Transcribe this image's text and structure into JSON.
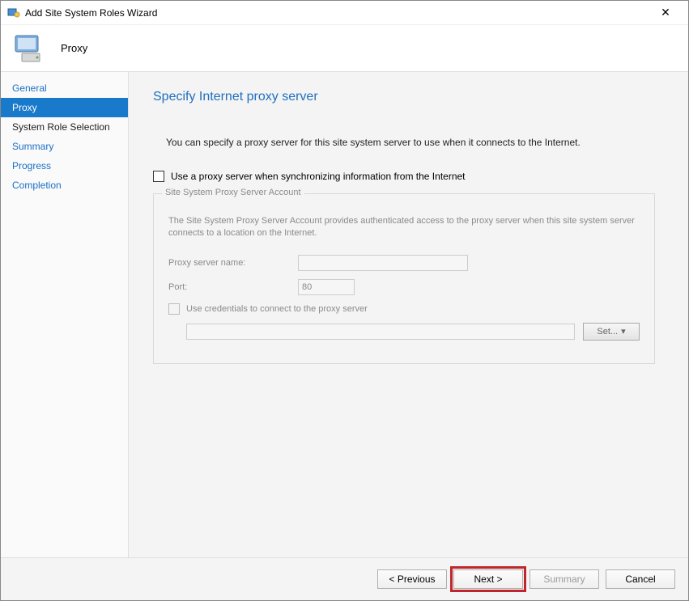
{
  "window": {
    "title": "Add Site System Roles Wizard"
  },
  "header": {
    "page_name": "Proxy"
  },
  "sidebar": {
    "items": [
      {
        "label": "General"
      },
      {
        "label": "Proxy"
      },
      {
        "label": "System Role Selection"
      },
      {
        "label": "Summary"
      },
      {
        "label": "Progress"
      },
      {
        "label": "Completion"
      }
    ],
    "selected_index": 1
  },
  "content": {
    "title": "Specify Internet proxy server",
    "description": "You can specify a proxy server for this site system server to use when it connects to the Internet.",
    "use_proxy_checkbox_label": "Use a proxy server when synchronizing information from the Internet",
    "use_proxy_checked": false,
    "group": {
      "title": "Site System Proxy Server Account",
      "description": "The Site System Proxy Server Account provides authenticated access to the proxy server when this site system server connects to a location on the Internet.",
      "proxy_name_label": "Proxy server name:",
      "proxy_name_value": "",
      "port_label": "Port:",
      "port_value": "80",
      "use_credentials_label": "Use credentials to connect to the proxy server",
      "use_credentials_checked": false,
      "credentials_value": "",
      "set_button_label": "Set..."
    }
  },
  "footer": {
    "previous": "< Previous",
    "next": "Next >",
    "summary": "Summary",
    "cancel": "Cancel"
  }
}
